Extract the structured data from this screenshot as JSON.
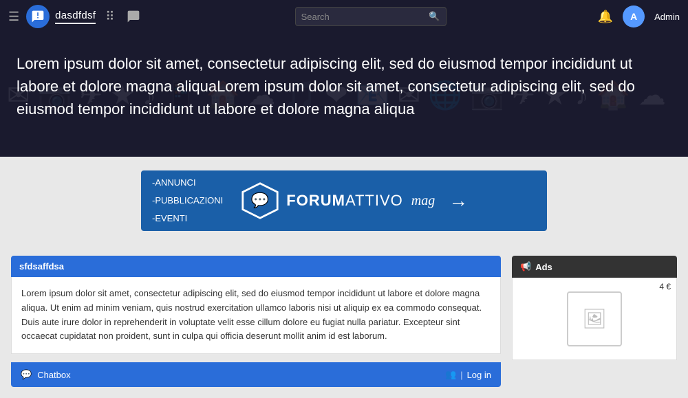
{
  "navbar": {
    "brand_name": "dasdfdsf",
    "search_placeholder": "Search",
    "admin_label": "Admin",
    "hamburger_icon": "☰",
    "grid_icon": "⋮⋮",
    "chat_icon": "💬",
    "bell_icon": "🔔"
  },
  "hero": {
    "text": "Lorem ipsum dolor sit amet, consectetur adipiscing elit, sed do eiusmod tempor incididunt ut labore et dolore magna aliquaLorem ipsum dolor sit amet, consectetur adipiscing elit, sed do eiusmod tempor incididunt ut labore et dolore magna aliqua"
  },
  "promo": {
    "lines": [
      "-ANNUNCI",
      "-PUBBLICAZIONI",
      "-EVENTI"
    ],
    "forum_bold": "FORUM",
    "forum_normal": "ATTIVO",
    "mag": "mag",
    "arrow": "→"
  },
  "card": {
    "header": "sfdsaffdsa",
    "body_text": "Lorem ipsum dolor sit amet, consectetur adipiscing elit, sed do eiusmod tempor incididunt ut labore et dolore magna aliqua. Ut enim ad minim veniam, quis nostrud exercitation ullamco laboris nisi ut aliquip ex ea commodo consequat. Duis aute irure dolor in reprehenderit in voluptate velit esse cillum dolore eu fugiat nulla pariatur. Excepteur sint occaecat cupidatat non proident, sunt in culpa qui officia deserunt mollit anim id est laborum."
  },
  "chatbox": {
    "label": "Chatbox",
    "users_icon": "👥",
    "pipe": "|",
    "login_label": "Log in"
  },
  "ads": {
    "header": "Ads",
    "ad_icon": "📢",
    "price": "4 €",
    "image_placeholder": "🖼"
  }
}
